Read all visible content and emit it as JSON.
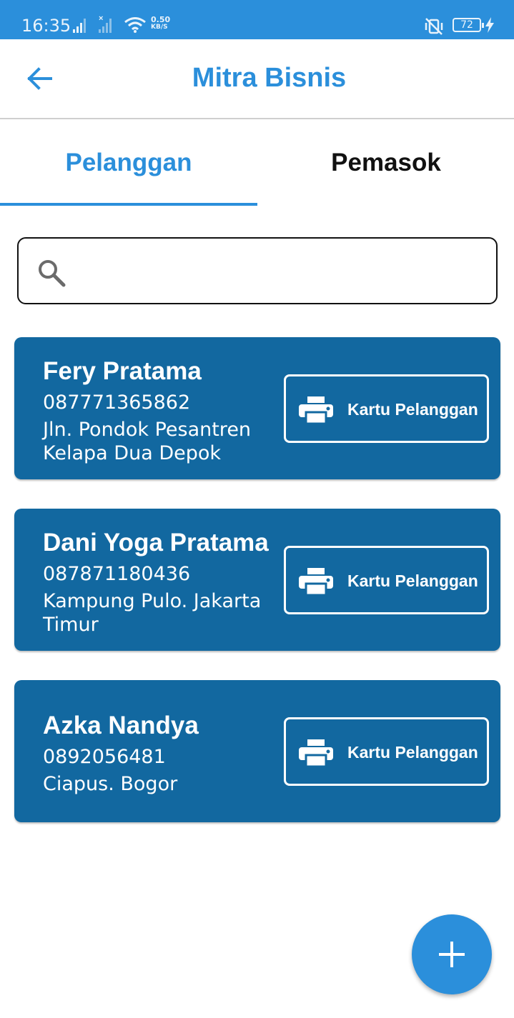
{
  "status_bar": {
    "time": "16:35",
    "net_speed_value": "0.50",
    "net_speed_unit": "KB/S",
    "battery": "72",
    "icons": [
      "signal-icon",
      "signal-icon",
      "wifi-icon",
      "mute-vibrate-icon",
      "battery-icon",
      "charging-icon"
    ]
  },
  "app_bar": {
    "title": "Mitra Bisnis",
    "back_icon": "arrow-left-icon"
  },
  "tabs": [
    {
      "label": "Pelanggan",
      "active": true
    },
    {
      "label": "Pemasok",
      "active": false
    }
  ],
  "search": {
    "value": "",
    "placeholder": "",
    "icon": "search-icon"
  },
  "customers": [
    {
      "name": "Fery Pratama",
      "phone": "087771365862",
      "address": "Jln. Pondok Pesantren Kelapa Dua Depok",
      "button_label": "Kartu Pelanggan"
    },
    {
      "name": "Dani Yoga Pratama",
      "phone": "087871180436",
      "address": "Kampung Pulo. Jakarta Timur",
      "button_label": "Kartu Pelanggan"
    },
    {
      "name": "Azka Nandya",
      "phone": "0892056481",
      "address": "Ciapus. Bogor",
      "button_label": "Kartu Pelanggan"
    }
  ],
  "fab": {
    "icon": "plus-icon"
  },
  "colors": {
    "primary": "#2b8fdb",
    "card": "#1268a0",
    "text_dark": "#111111"
  }
}
